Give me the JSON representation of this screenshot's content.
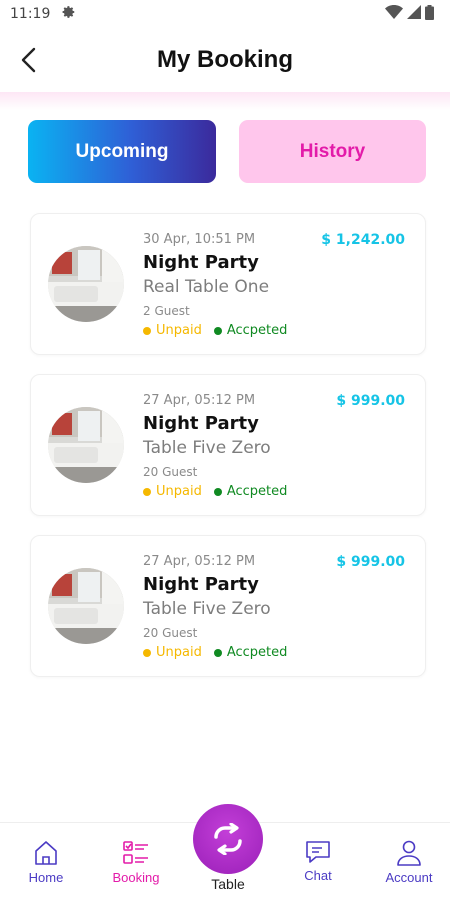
{
  "status_bar": {
    "time": "11:19"
  },
  "header": {
    "title": "My Booking"
  },
  "tabs": [
    {
      "label": "Upcoming"
    },
    {
      "label": "History"
    }
  ],
  "bookings": [
    {
      "date": "30 Apr, 10:51 PM",
      "price": "$ 1,242.00",
      "title": "Night Party",
      "table": "Real Table One",
      "guests": "2 Guest",
      "payment_status": "Unpaid",
      "booking_status": "Accpeted"
    },
    {
      "date": "27 Apr, 05:12 PM",
      "price": "$ 999.00",
      "title": "Night Party",
      "table": "Table Five Zero",
      "guests": "20 Guest",
      "payment_status": "Unpaid",
      "booking_status": "Accpeted"
    },
    {
      "date": "27 Apr, 05:12 PM",
      "price": "$ 999.00",
      "title": "Night Party",
      "table": "Table Five Zero",
      "guests": "20 Guest",
      "payment_status": "Unpaid",
      "booking_status": "Accpeted"
    }
  ],
  "nav": {
    "home": "Home",
    "booking": "Booking",
    "table": "Table",
    "chat": "Chat",
    "account": "Account"
  },
  "colors": {
    "accent_pink": "#e31ba9",
    "accent_cyan": "#16c4e6",
    "unpaid": "#f5b800",
    "accepted": "#108a22",
    "nav_purple": "#4b3bc4"
  }
}
